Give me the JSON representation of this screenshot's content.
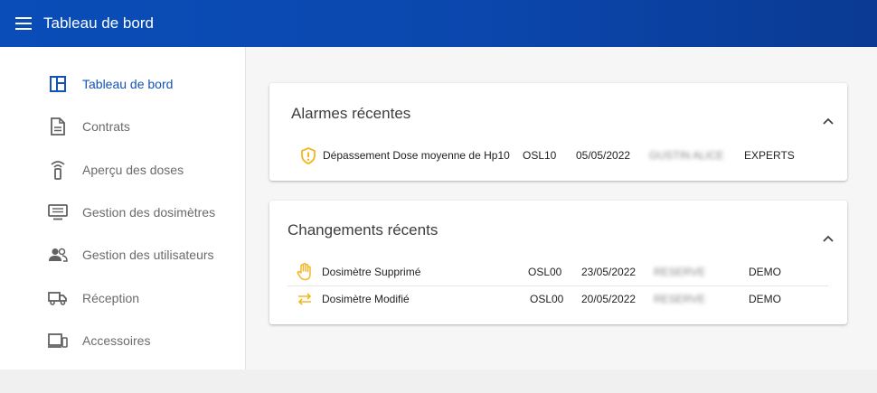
{
  "header": {
    "title": "Tableau de bord"
  },
  "sidebar": {
    "items": [
      {
        "label": "Tableau de bord",
        "icon": "dashboard-icon",
        "active": true
      },
      {
        "label": "Contrats",
        "icon": "document-icon"
      },
      {
        "label": "Aperçu des doses",
        "icon": "dosimeter-icon"
      },
      {
        "label": "Gestion des dosimètres",
        "icon": "monitor-icon"
      },
      {
        "label": "Gestion des utilisateurs",
        "icon": "users-icon"
      },
      {
        "label": "Réception",
        "icon": "truck-icon"
      },
      {
        "label": "Accessoires",
        "icon": "devices-icon"
      }
    ]
  },
  "alarms": {
    "title": "Alarmes récentes",
    "rows": [
      {
        "icon": "shield-alert-icon",
        "event": "Dépassement Dose moyenne de Hp10",
        "code": "OSL10",
        "date": "05/05/2022",
        "user": "GUSTIN ALICE",
        "group": "EXPERTS"
      }
    ]
  },
  "changes": {
    "title": "Changements récents",
    "rows": [
      {
        "icon": "hand-stop-icon",
        "event": "Dosimètre Supprimé",
        "code": "OSL00",
        "date": "23/05/2022",
        "user": "RESERVE",
        "group": "DEMO"
      },
      {
        "icon": "swap-arrows-icon",
        "event": "Dosimètre Modifié",
        "code": "OSL00",
        "date": "20/05/2022",
        "user": "RESERVE",
        "group": "DEMO"
      }
    ]
  },
  "colors": {
    "header_blue": "#0a4db8",
    "active_blue": "#1352b8",
    "icon_amber": "#f2b824",
    "icon_gray": "#616161"
  }
}
